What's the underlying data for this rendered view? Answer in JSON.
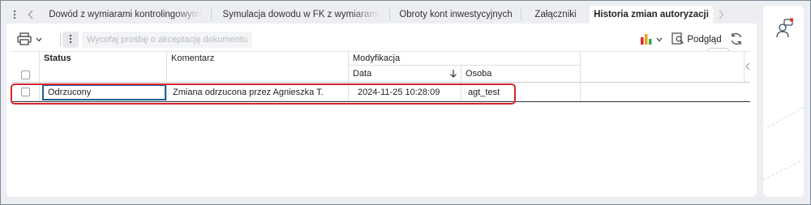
{
  "tabs": [
    {
      "label": "Dowód z wymiarami kontrolingowymi",
      "active": false
    },
    {
      "label": "Symulacja dowodu w FK z wymiarami",
      "active": false
    },
    {
      "label": "Obroty kont inwestycyjnych",
      "active": false
    },
    {
      "label": "Załączniki",
      "active": false
    },
    {
      "label": "Historia zmian autoryzacji",
      "active": true
    }
  ],
  "toolbar": {
    "withdraw_label": "Wycofaj prośbę o akceptację dokumentu",
    "preview_label": "Podgląd"
  },
  "table": {
    "col_status": "Status",
    "col_comment": "Komentarz",
    "group_modification": "Modyfikacja",
    "col_date": "Data",
    "col_person": "Osoba",
    "rows": [
      {
        "status": "Odrzucony",
        "comment": "Zmiana odrzucona przez Agnieszka T.",
        "date": "2024-11-25 10:28:09",
        "person": "agt_test"
      }
    ]
  },
  "colors": {
    "highlight": "#d9262c",
    "focus": "#1f5f9e",
    "chart_bars": [
      "#d9262c",
      "#f0a020",
      "#3aa84a"
    ]
  },
  "icons": [
    "more-vert-icon",
    "chevron-left-icon",
    "chevron-right-icon",
    "print-icon",
    "chevron-down-icon",
    "more-dots-icon",
    "chart-icon",
    "preview-icon",
    "refresh-icon",
    "support-chat-icon"
  ]
}
